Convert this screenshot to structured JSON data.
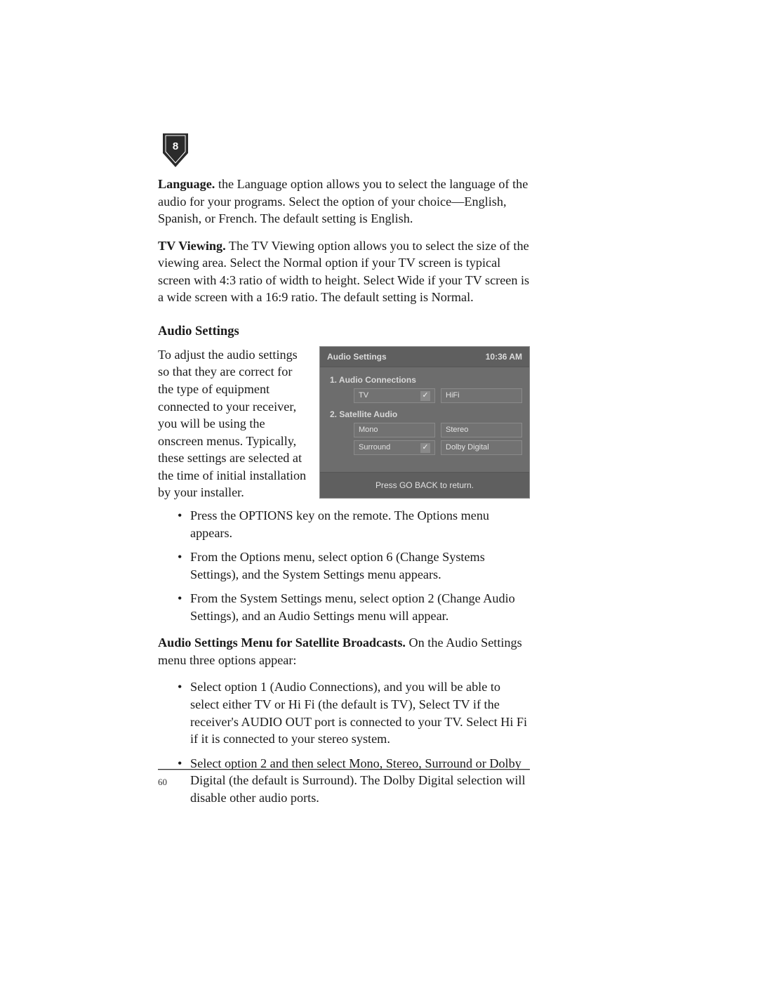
{
  "bookmark": {
    "number": "8"
  },
  "para1": {
    "lead": "Language.",
    "text": " the Language option allows you to select the language of the audio for your programs. Select the option of your choice—English, Spanish, or French. The default setting is English."
  },
  "para2": {
    "lead": "TV Viewing.",
    "text": " The TV Viewing option allows you to select the size of the viewing area. Select the Normal option if your TV screen is typical screen with 4:3 ratio of width to height. Select Wide if your TV screen is a wide screen with a 16:9 ratio. The default setting is Normal."
  },
  "section_heading": "Audio Settings",
  "intro": "To adjust the audio settings so that they are correct for the type of equipment connected to your receiver, you will be using the onscreen menus. Typically, these settings are selected at the time of initial installation by your installer.",
  "figure": {
    "title": "Audio Settings",
    "time": "10:36 AM",
    "item1_label": "1.  Audio Connections",
    "item1_opts": {
      "a": "TV",
      "b": "HiFi",
      "selected": "a"
    },
    "item2_label": "2.  Satellite Audio",
    "item2_opts_r1": {
      "a": "Mono",
      "b": "Stereo"
    },
    "item2_opts_r2": {
      "a": "Surround",
      "b": "Dolby Digital",
      "selected": "a"
    },
    "footer": "Press GO BACK to return."
  },
  "steps": {
    "a": "Press the OPTIONS key on the remote. The Options menu appears.",
    "b": "From the Options menu, select option 6 (Change Systems Settings), and the System Settings menu appears.",
    "c": "From the System Settings menu, select option 2 (Change Audio Settings), and an Audio Settings menu will appear."
  },
  "para3": {
    "lead": "Audio Settings Menu for Satellite Broadcasts.",
    "text": " On the Audio Settings menu three options appear:"
  },
  "opts": {
    "a": "Select option 1 (Audio Connections), and you will be able to select either TV or Hi Fi (the default is TV), Select TV if the receiver's AUDIO OUT port is connected to your TV. Select Hi Fi if it is connected to your stereo system.",
    "b": "Select option 2 and then select Mono, Stereo, Surround or Dolby Digital (the default is Surround). The Dolby Digital selection will disable other audio ports."
  },
  "page_number": "60"
}
